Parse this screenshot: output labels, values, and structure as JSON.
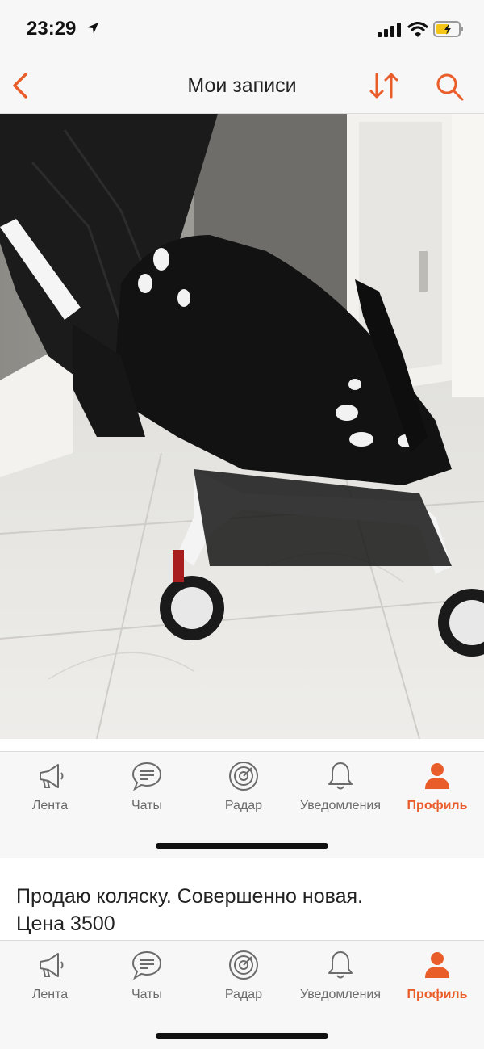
{
  "status_bar": {
    "time": "23:29"
  },
  "header": {
    "title": "Мои записи"
  },
  "post": {
    "description_line1": "Продаю коляску. Совершенно новая.",
    "description_line2": "Цена 3500"
  },
  "tabs": [
    {
      "label": "Лента",
      "icon": "megaphone-icon",
      "active": false
    },
    {
      "label": "Чаты",
      "icon": "chat-bubble-icon",
      "active": false
    },
    {
      "label": "Радар",
      "icon": "radar-icon",
      "active": false
    },
    {
      "label": "Уведомления",
      "icon": "bell-icon",
      "active": false
    },
    {
      "label": "Профиль",
      "icon": "person-icon",
      "active": true
    }
  ],
  "colors": {
    "accent": "#e95d2a",
    "inactive": "#6b6b6b",
    "bar_bg": "#f7f7f7"
  }
}
